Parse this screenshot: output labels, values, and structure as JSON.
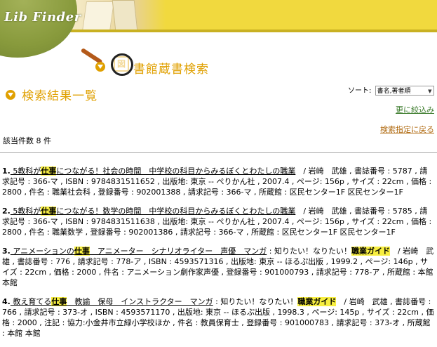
{
  "header": {
    "logo_text": "Lib Finder"
  },
  "search_title": "書館蔵書検索",
  "search_title_badge": "図",
  "results_title": "検索結果一覧",
  "sort": {
    "label": "ソート:",
    "selected": "書名,著者順"
  },
  "links": {
    "narrow": "更に絞込み",
    "back": "検索指定に戻る"
  },
  "count_text": "該当件数 8 件",
  "records": [
    {
      "num": "1.",
      "pre": " 5教科が",
      "hl": "仕事",
      "title_rest": "につながる！社会の時間　中学校の科目からみるぼくとわたしの職業",
      "tail": "　/ 岩崎　武雄 , 書誌番号 : 5787 , 請求記号 : 366-マ , ISBN : 9784831511652 , 出版地: 東京 -- ぺりかん社 , 2007.4 , ページ: 156p , サイズ : 22cm , 価格 : 2800 , 件名 : 職業社会科 , 登録番号 : 902001388 , 請求記号 : 366-マ , 所蔵館 : 区民センター1F 区民センター1F"
    },
    {
      "num": "2.",
      "pre": " 5教科が",
      "hl": "仕事",
      "title_rest": "につながる！数学の時間　中学校の科目からみるぼくとわたしの職業",
      "tail": "　/ 岩崎　武雄 , 書誌番号 : 5785 , 請求記号 : 366-マ , ISBN : 9784831511638 , 出版地: 東京 -- ぺりかん社 , 2007.4 , ページ: 156p , サイズ : 22cm , 価格 : 2800 , 件名 : 職業数学 , 登録番号 : 902001386 , 請求記号 : 366-マ , 所蔵館 : 区民センター1F 区民センター1F"
    },
    {
      "num": "3.",
      "pre": " アニメーションの",
      "hl": "仕事",
      "title_rest": "　アニメーター　シナリオライター　声優　マンガ",
      "mid": " : 知りたい！なりたい！",
      "hl2": "職業ガイド",
      "tail": "　/ 岩崎　武雄 , 書誌番号 : 776 , 請求記号 : 778-ア , ISBN : 4593571316 , 出版地: 東京 -- ほるぷ出版 , 1999.2 , ページ: 146p , サイズ : 22cm , 価格 : 2000 , 件名 : アニメーション劇作家声優 , 登録番号 : 901000793 , 請求記号 : 778-ア , 所蔵館 : 本館 本館"
    },
    {
      "num": "4.",
      "pre": " 教え育てる",
      "hl": "仕事",
      "title_rest": "　教諭　保母　インストラクター　マンガ",
      "mid": " : 知りたい！なりたい！",
      "hl2": "職業ガイド",
      "tail": "　/ 岩崎　武雄 , 書誌番号 : 766 , 請求記号 : 373-オ , ISBN : 4593571170 , 出版地: 東京 -- ほるぷ出版 , 1998.3 , ページ: 145p , サイズ : 22cm , 価格 : 2000 , 注記 : 協力:小金井市立緑小学校ほか , 件名 : 教員保育士 , 登録番号 : 901000783 , 請求記号 : 373-オ , 所蔵館 : 本館 本館"
    }
  ]
}
